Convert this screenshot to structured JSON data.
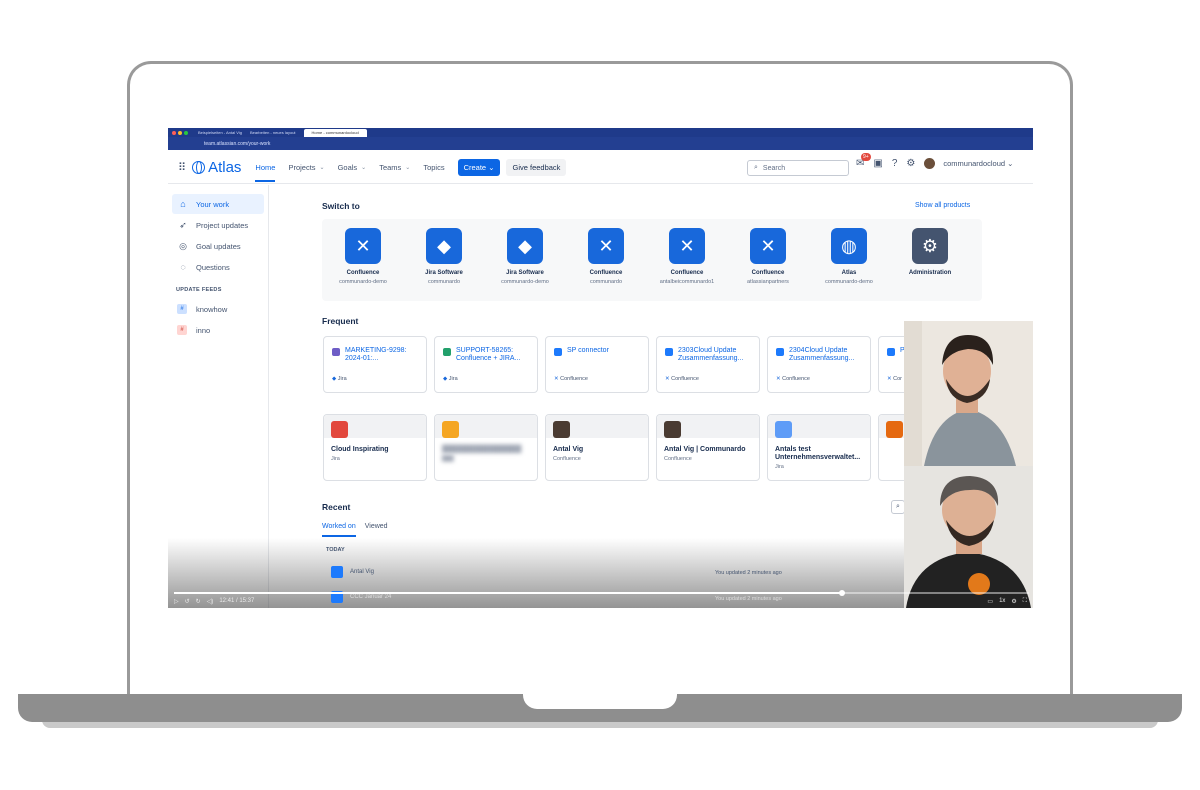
{
  "browser": {
    "tabs": [
      "Beispielseiten - Antal Vig",
      "Bearbeiten - neues layout",
      "Home - communardocloud"
    ],
    "url": "team.atlassian.com/your-work"
  },
  "topnav": {
    "logo": "Atlas",
    "items": [
      "Home",
      "Projects",
      "Goals",
      "Teams",
      "Topics"
    ],
    "create_label": "Create",
    "feedback_label": "Give feedback",
    "search_placeholder": "Search",
    "notification_badge": "9+",
    "user": "communardocloud"
  },
  "sidebar": {
    "items": [
      "Your work",
      "Project updates",
      "Goal updates",
      "Questions"
    ],
    "feeds_heading": "UPDATE FEEDS",
    "feeds": [
      "knowhow",
      "inno"
    ]
  },
  "switch_to": {
    "title": "Switch to",
    "show_all": "Show all products",
    "products": [
      {
        "name": "Confluence",
        "site": "communardo-demo",
        "icon": "confluence-icon"
      },
      {
        "name": "Jira Software",
        "site": "communardo",
        "icon": "jira-icon"
      },
      {
        "name": "Jira Software",
        "site": "communardo-demo",
        "icon": "jira-icon"
      },
      {
        "name": "Confluence",
        "site": "communardo",
        "icon": "confluence-icon"
      },
      {
        "name": "Confluence",
        "site": "antalbeicommunardo1",
        "icon": "confluence-icon"
      },
      {
        "name": "Confluence",
        "site": "atlassianpartners",
        "icon": "confluence-icon"
      },
      {
        "name": "Atlas",
        "site": "communardo-demo",
        "icon": "atlas-icon"
      },
      {
        "name": "Administration",
        "site": "",
        "icon": "gear-icon"
      }
    ]
  },
  "frequent": {
    "title": "Frequent",
    "items": [
      {
        "title": "MARKETING-9298: 2024-01:...",
        "source": "Jira"
      },
      {
        "title": "SUPPORT-58265: Confluence + JIRA...",
        "source": "Jira"
      },
      {
        "title": "SP connector",
        "source": "Confluence"
      },
      {
        "title": "2303Cloud Update Zusammenfassung...",
        "source": "Confluence"
      },
      {
        "title": "2304Cloud Update Zusammenfassung...",
        "source": "Confluence"
      },
      {
        "title": "Pr",
        "source": "Cor"
      }
    ],
    "places": [
      {
        "title": "Cloud Inspirating",
        "source": "Jira"
      },
      {
        "title": "",
        "source": ""
      },
      {
        "title": "Antal Vig",
        "source": "Confluence"
      },
      {
        "title": "Antal Vig | Communardo",
        "source": "Confluence"
      },
      {
        "title": "Antals test Unternehmensverwaltet...",
        "source": "Jira"
      }
    ]
  },
  "recent": {
    "title": "Recent",
    "tabs": [
      "Worked on",
      "Viewed"
    ],
    "group": "TODAY",
    "rows": [
      {
        "title": "Antal Vig",
        "status": "You updated 2 minutes ago"
      },
      {
        "title": "CCC Januar 24",
        "status": "You updated 2 minutes ago"
      }
    ]
  },
  "video": {
    "time": "12:41 / 15:37",
    "speed": "1x",
    "progress_fraction": 0.78
  },
  "colors": {
    "primary": "#0c66e4",
    "confluence": "#1868db",
    "browser_chrome": "#1f3a8a"
  }
}
